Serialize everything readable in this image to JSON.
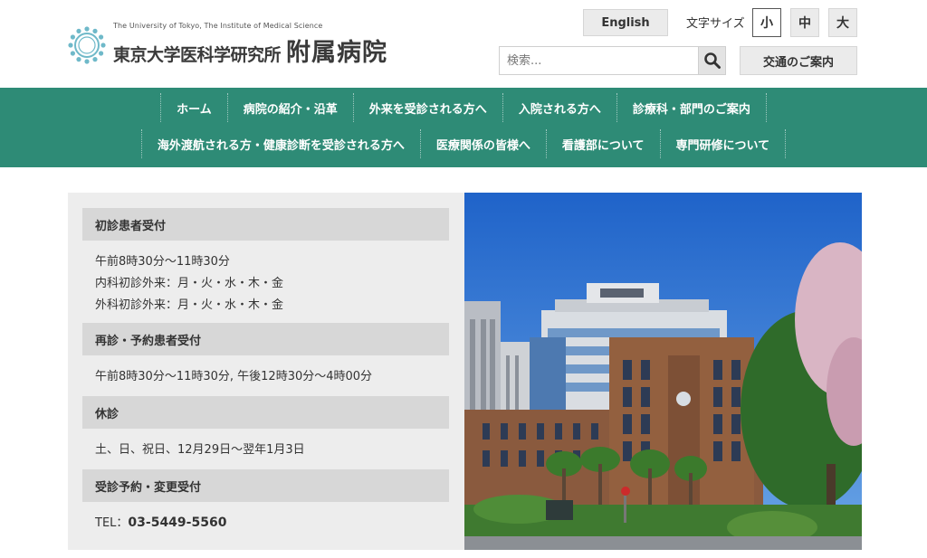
{
  "header": {
    "logo_en": "The University of Tokyo, The Institute of Medical Science",
    "logo_jp": "東京大学医科学研究所",
    "logo_jp_big": "附属病院",
    "english_label": "English",
    "fontsize_label": "文字サイズ",
    "fontsize_options": [
      "小",
      "中",
      "大"
    ],
    "fontsize_selected": "小",
    "search_placeholder": "検索...",
    "access_label": "交通のご案内"
  },
  "nav": {
    "row1": [
      "ホーム",
      "病院の紹介・沿革",
      "外来を受診される方へ",
      "入院される方へ",
      "診療科・部門のご案内"
    ],
    "row2": [
      "海外渡航される方・健康診断を受診される方へ",
      "医療関係の皆様へ",
      "看護部について",
      "専門研修について"
    ],
    "background": "#2e8b76"
  },
  "info": {
    "sections": [
      {
        "heading": "初診患者受付",
        "lines": [
          "午前8時30分～11時30分",
          "内科初診外来：月・火・水・木・金",
          "外科初診外来：月・火・水・木・金"
        ]
      },
      {
        "heading": "再診・予約患者受付",
        "lines": [
          "午前8時30分～11時30分, 午後12時30分～4時00分"
        ]
      },
      {
        "heading": "休診",
        "lines": [
          "土、日、祝日、12月29日～翌年1月3日"
        ]
      },
      {
        "heading": "受診予約・変更受付",
        "tel_prefix": "TEL：",
        "tel_number": "03-5449-5560"
      }
    ]
  },
  "icons": {
    "search": "search-icon",
    "logo": "university-seal-icon"
  }
}
